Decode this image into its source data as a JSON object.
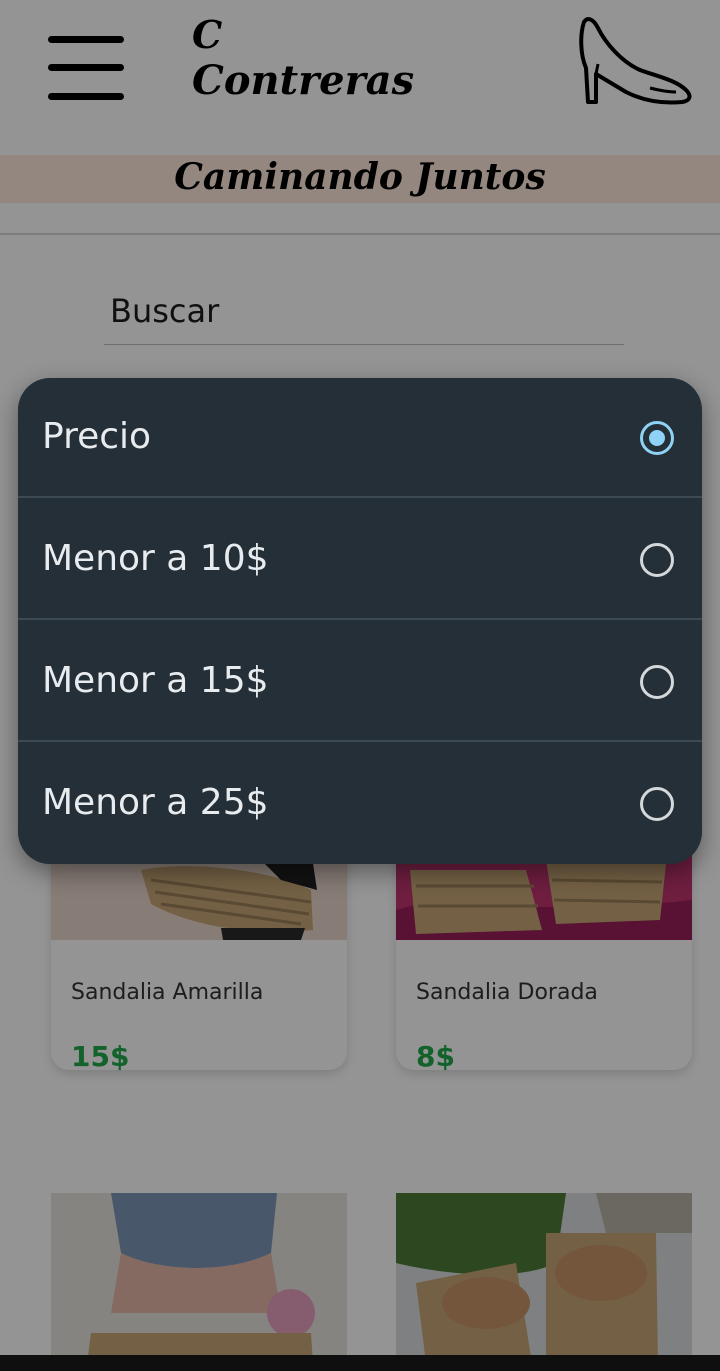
{
  "header": {
    "brand_initial": "C",
    "brand_name": "Contreras",
    "tagline": "Caminando Juntos"
  },
  "search": {
    "label": "Buscar"
  },
  "products": [
    {
      "name": "Sandalia Amarilla",
      "price": "15$"
    },
    {
      "name": "Sandalia Dorada",
      "price": "8$"
    }
  ],
  "filter_dialog": {
    "options": [
      {
        "label": "Precio",
        "selected": true
      },
      {
        "label": "Menor a 10$",
        "selected": false
      },
      {
        "label": "Menor a 15$",
        "selected": false
      },
      {
        "label": "Menor a 25$",
        "selected": false
      }
    ]
  },
  "colors": {
    "dialog_bg": "#242f37",
    "radio_selected": "#8fd2f5",
    "price": "#22a84a",
    "tagline_band": "#fde9dc"
  },
  "icons": [
    "hamburger-menu-icon",
    "high-heel-shoe-logo-icon",
    "radio-selected-icon",
    "radio-unselected-icon"
  ]
}
